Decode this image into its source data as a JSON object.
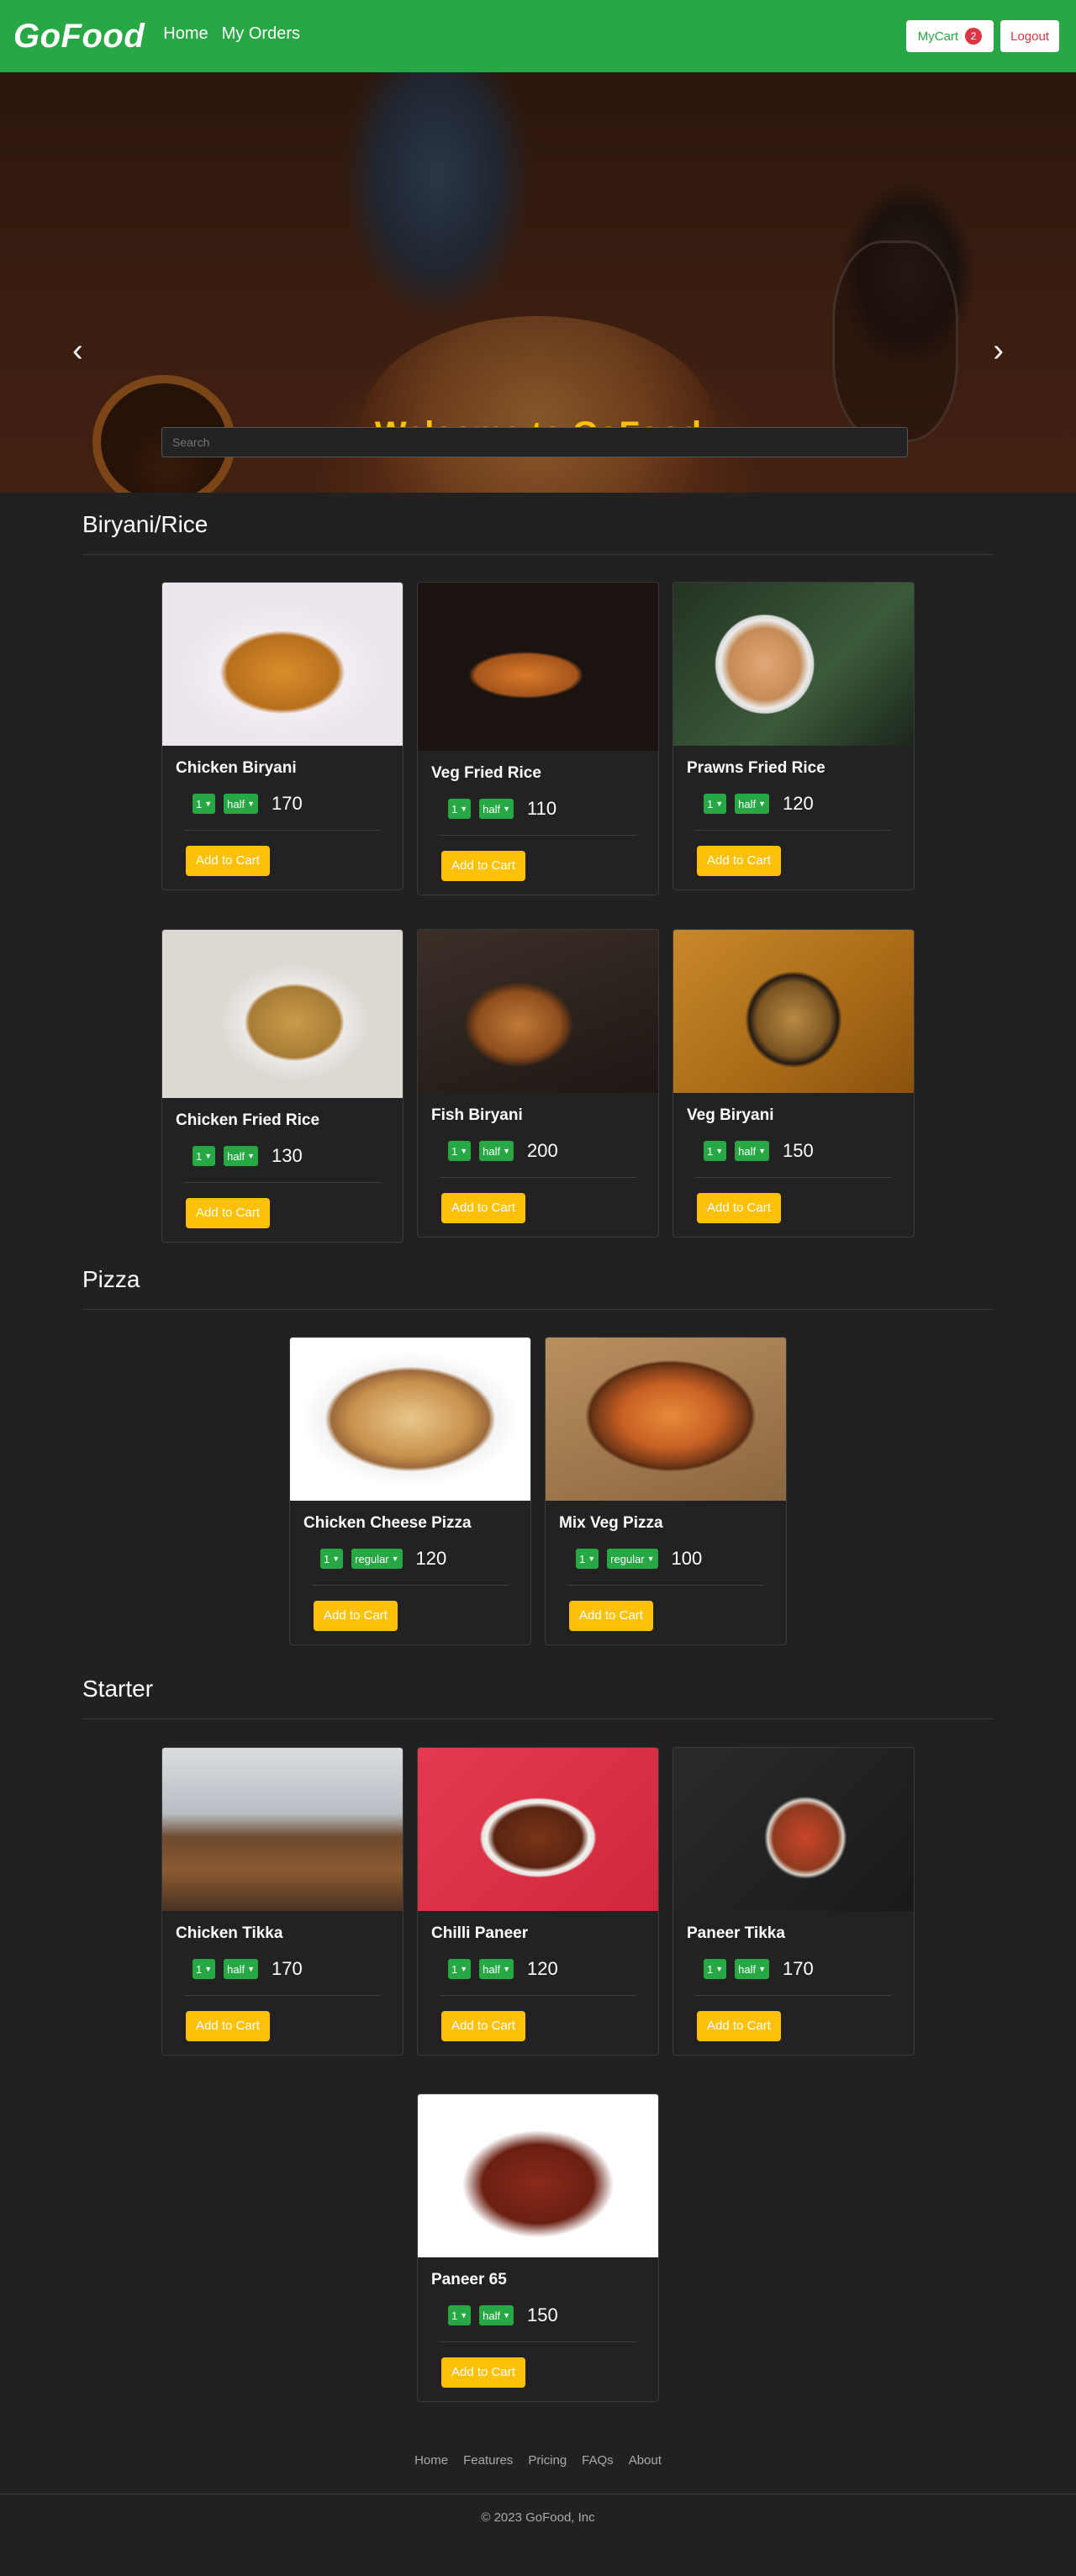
{
  "navbar": {
    "brand": "GoFood",
    "links": [
      "Home",
      "My Orders"
    ],
    "cart_label": "MyCart",
    "cart_count": "2",
    "logout_label": "Logout",
    "color": "#28a745"
  },
  "hero": {
    "title": "Welcome to GoFood",
    "search_placeholder": "Search",
    "prev_icon": "chevron-left-icon",
    "next_icon": "chevron-right-icon"
  },
  "categories": [
    {
      "name": "Biryani/Rice",
      "items": [
        {
          "name": "Chicken Biryani",
          "qty": "1",
          "size": "half",
          "price": "170"
        },
        {
          "name": "Veg Fried Rice",
          "qty": "1",
          "size": "half",
          "price": "110"
        },
        {
          "name": "Prawns Fried Rice",
          "qty": "1",
          "size": "half",
          "price": "120"
        },
        {
          "name": "Chicken Fried Rice",
          "qty": "1",
          "size": "half",
          "price": "130"
        },
        {
          "name": "Fish Biryani",
          "qty": "1",
          "size": "half",
          "price": "200"
        },
        {
          "name": "Veg Biryani",
          "qty": "1",
          "size": "half",
          "price": "150"
        }
      ]
    },
    {
      "name": "Pizza",
      "items": [
        {
          "name": "Chicken Cheese Pizza",
          "qty": "1",
          "size": "regular",
          "price": "120"
        },
        {
          "name": "Mix Veg Pizza",
          "qty": "1",
          "size": "regular",
          "price": "100"
        }
      ]
    },
    {
      "name": "Starter",
      "items": [
        {
          "name": "Chicken Tikka",
          "qty": "1",
          "size": "half",
          "price": "170"
        },
        {
          "name": "Chilli Paneer",
          "qty": "1",
          "size": "half",
          "price": "120"
        },
        {
          "name": "Paneer Tikka",
          "qty": "1",
          "size": "half",
          "price": "170"
        },
        {
          "name": "Paneer 65",
          "qty": "1",
          "size": "half",
          "price": "150"
        }
      ]
    }
  ],
  "add_to_cart_label": "Add to Cart",
  "footer": {
    "links": [
      "Home",
      "Features",
      "Pricing",
      "FAQs",
      "About"
    ],
    "copyright": "© 2023 GoFood, Inc"
  }
}
